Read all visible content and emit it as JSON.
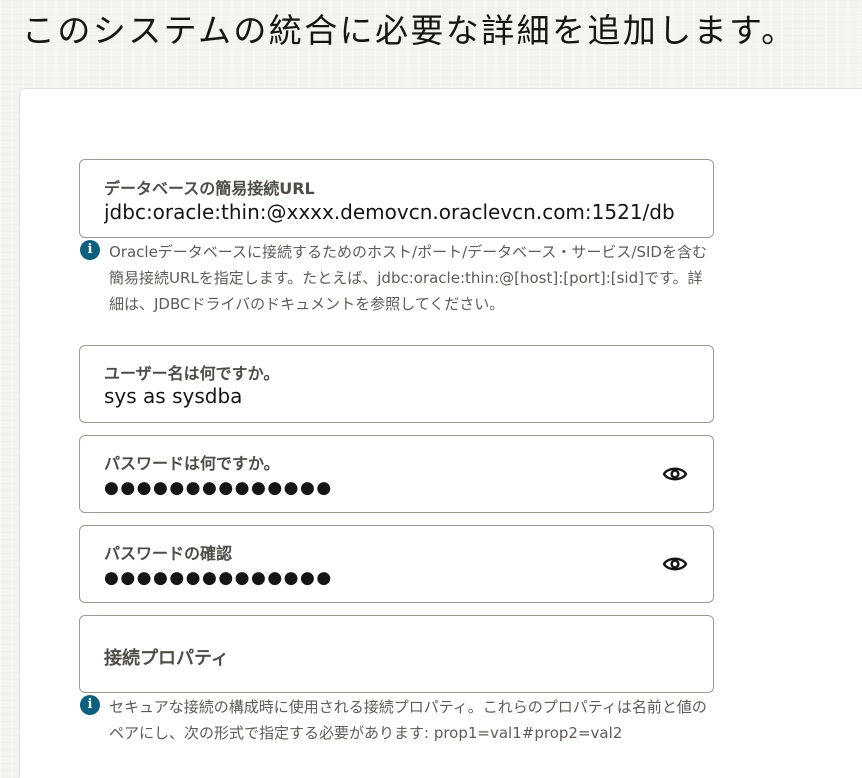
{
  "page": {
    "title": "このシステムの統合に必要な詳細を追加します。"
  },
  "form": {
    "connection_url": {
      "label": "データベースの簡易接続URL",
      "value": "jdbc:oracle:thin:@xxxx.demovcn.oraclevcn.com:1521/db",
      "help": "Oracleデータベースに接続するためのホスト/ポート/データベース・サービス/SIDを含む簡易接続URLを指定します。たとえば、jdbc:oracle:thin:@[host]:[port]:[sid]です。詳細は、JDBCドライバのドキュメントを参照してください。"
    },
    "username": {
      "label": "ユーザー名は何ですか。",
      "value": "sys as sysdba"
    },
    "password": {
      "label": "パスワードは何ですか。",
      "masked_value": "●●●●●●●●●●●●●●"
    },
    "password_confirm": {
      "label": "パスワードの確認",
      "masked_value": "●●●●●●●●●●●●●●"
    },
    "connection_properties": {
      "label": "接続プロパティ",
      "value": "",
      "help": "セキュアな接続の構成時に使用される接続プロパティ。これらのプロパティは名前と値のペアにし、次の形式で指定する必要があります: prop1=val1#prop2=val2"
    }
  },
  "icons": {
    "info": "info-icon",
    "show_password": "eye-icon"
  },
  "colors": {
    "info_icon": "#0b5f7f",
    "field_border": "#9e9892",
    "label": "#4f4c47",
    "help_text": "#5f5b56"
  }
}
